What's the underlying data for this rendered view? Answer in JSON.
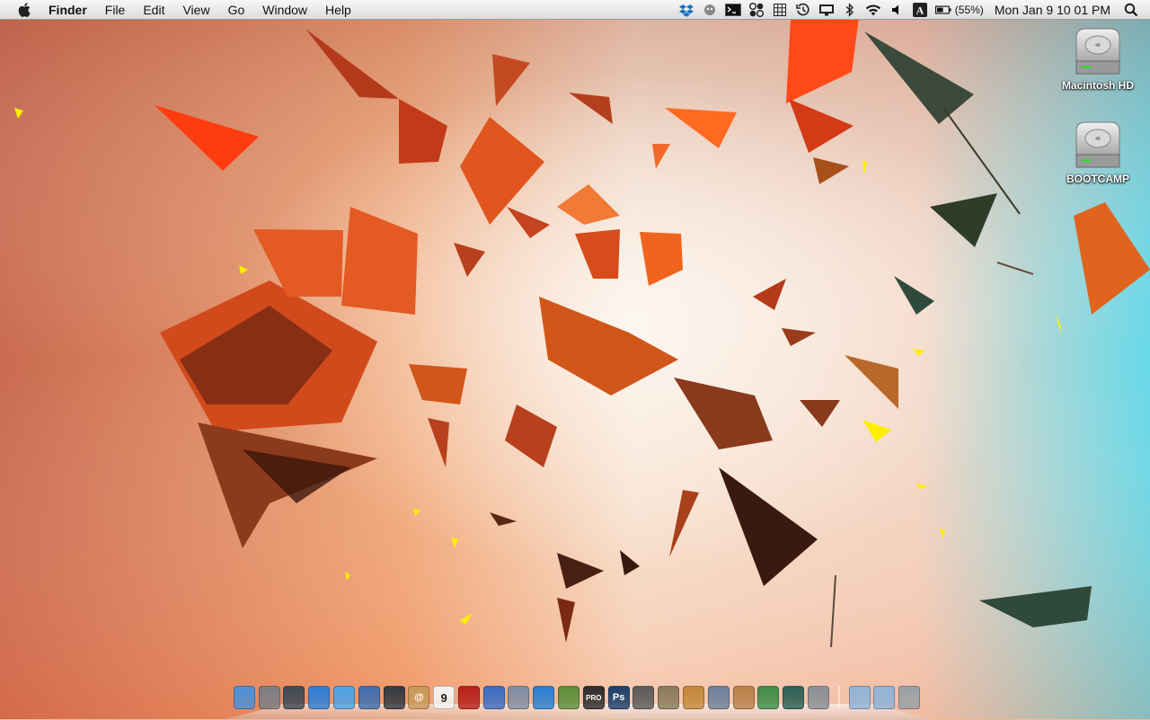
{
  "menubar": {
    "app_name": "Finder",
    "menus": [
      "File",
      "Edit",
      "View",
      "Go",
      "Window",
      "Help"
    ],
    "tray_icons": [
      "dropbox-icon",
      "growl-icon",
      "terminal-icon",
      "menu-meters-icon",
      "grid-icon",
      "time-machine-icon",
      "display-icon",
      "bluetooth-icon",
      "wifi-icon",
      "volume-icon",
      "input-source-icon",
      "battery-icon"
    ],
    "input_source": "A",
    "battery_text": "(55%)",
    "clock_text": "Mon Jan 9  10 01 PM",
    "spotlight_icon": "spotlight-icon"
  },
  "desktop": {
    "icons": [
      {
        "label": "Macintosh HD",
        "icon": "hard-drive-icon"
      },
      {
        "label": "BOOTCAMP",
        "icon": "hard-drive-icon"
      }
    ]
  },
  "dock": {
    "apps": [
      {
        "name": "finder-icon",
        "color": "#4a90d9",
        "glyph": ""
      },
      {
        "name": "launchpad-icon",
        "color": "#7b7f86",
        "glyph": ""
      },
      {
        "name": "mission-control-icon",
        "color": "#3d4a57",
        "glyph": ""
      },
      {
        "name": "app-store-icon",
        "color": "#2e7fd8",
        "glyph": ""
      },
      {
        "name": "safari-icon",
        "color": "#4aa3e8",
        "glyph": ""
      },
      {
        "name": "preview-icon",
        "color": "#3e6fb0",
        "glyph": ""
      },
      {
        "name": "facetime-icon",
        "color": "#333a41",
        "glyph": ""
      },
      {
        "name": "address-book-icon",
        "color": "#c79a5a",
        "glyph": "@"
      },
      {
        "name": "ical-icon",
        "color": "#f4f4f4",
        "glyph": "9"
      },
      {
        "name": "photo-booth-icon",
        "color": "#b8201c",
        "glyph": ""
      },
      {
        "name": "xcode-icon",
        "color": "#3b6cc5",
        "glyph": ""
      },
      {
        "name": "iphoto-icon",
        "color": "#7f8ea5",
        "glyph": ""
      },
      {
        "name": "itunes-icon",
        "color": "#2a7fd2",
        "glyph": ""
      },
      {
        "name": "minecraft-icon",
        "color": "#5b8f3a",
        "glyph": ""
      },
      {
        "name": "final-cut-pro-icon",
        "color": "#2c2c2c",
        "glyph": "PRO"
      },
      {
        "name": "photoshop-icon",
        "color": "#1b3f6a",
        "glyph": "Ps"
      },
      {
        "name": "aperture-icon",
        "color": "#5a5a5a",
        "glyph": ""
      },
      {
        "name": "gimp-icon",
        "color": "#8a7b5a",
        "glyph": ""
      },
      {
        "name": "garageband-icon",
        "color": "#c4883a",
        "glyph": ""
      },
      {
        "name": "script-editor-icon",
        "color": "#6d7f9a",
        "glyph": ""
      },
      {
        "name": "keynote-icon",
        "color": "#b9804a",
        "glyph": ""
      },
      {
        "name": "numbers-icon",
        "color": "#3d8e48",
        "glyph": ""
      },
      {
        "name": "time-machine-app-icon",
        "color": "#2a5f55",
        "glyph": ""
      },
      {
        "name": "system-preferences-icon",
        "color": "#8a8f96",
        "glyph": ""
      }
    ],
    "stacks": [
      {
        "name": "applications-folder-icon",
        "color": "#8fb3d8"
      },
      {
        "name": "downloads-folder-icon",
        "color": "#8fb3d8"
      },
      {
        "name": "trash-icon",
        "color": "#9aa0a6"
      }
    ]
  }
}
